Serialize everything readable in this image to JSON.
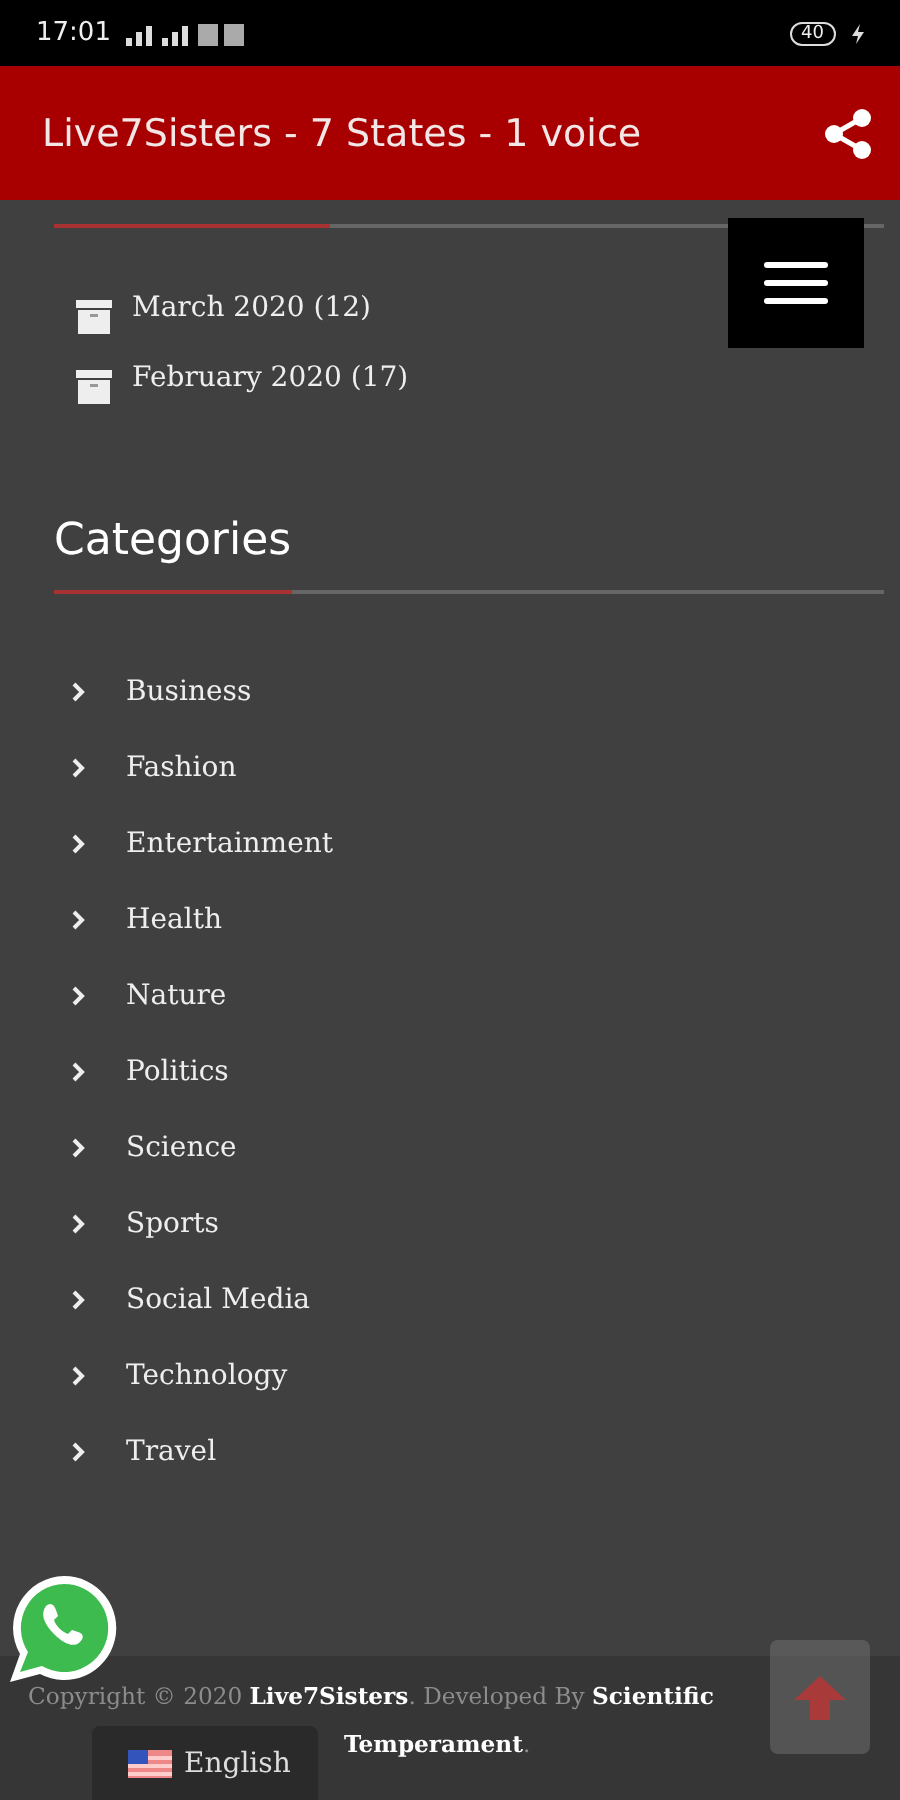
{
  "status_bar": {
    "time": "17:01",
    "battery": "40"
  },
  "app_bar": {
    "title": "Live7Sisters - 7 States - 1 voice"
  },
  "archives": [
    {
      "label": "March 2020 (12)"
    },
    {
      "label": "February 2020 (17)"
    }
  ],
  "categories": {
    "title": "Categories",
    "items": [
      "Business",
      "Fashion",
      "Entertainment",
      "Health",
      "Nature",
      "Politics",
      "Science",
      "Sports",
      "Social Media",
      "Technology",
      "Travel"
    ]
  },
  "footer": {
    "copyright_lines": [
      "Copyright © 2020 **Live7Sisters**. Developed By **Scientific**",
      "**Temperament**."
    ]
  },
  "language": {
    "label": "English"
  }
}
